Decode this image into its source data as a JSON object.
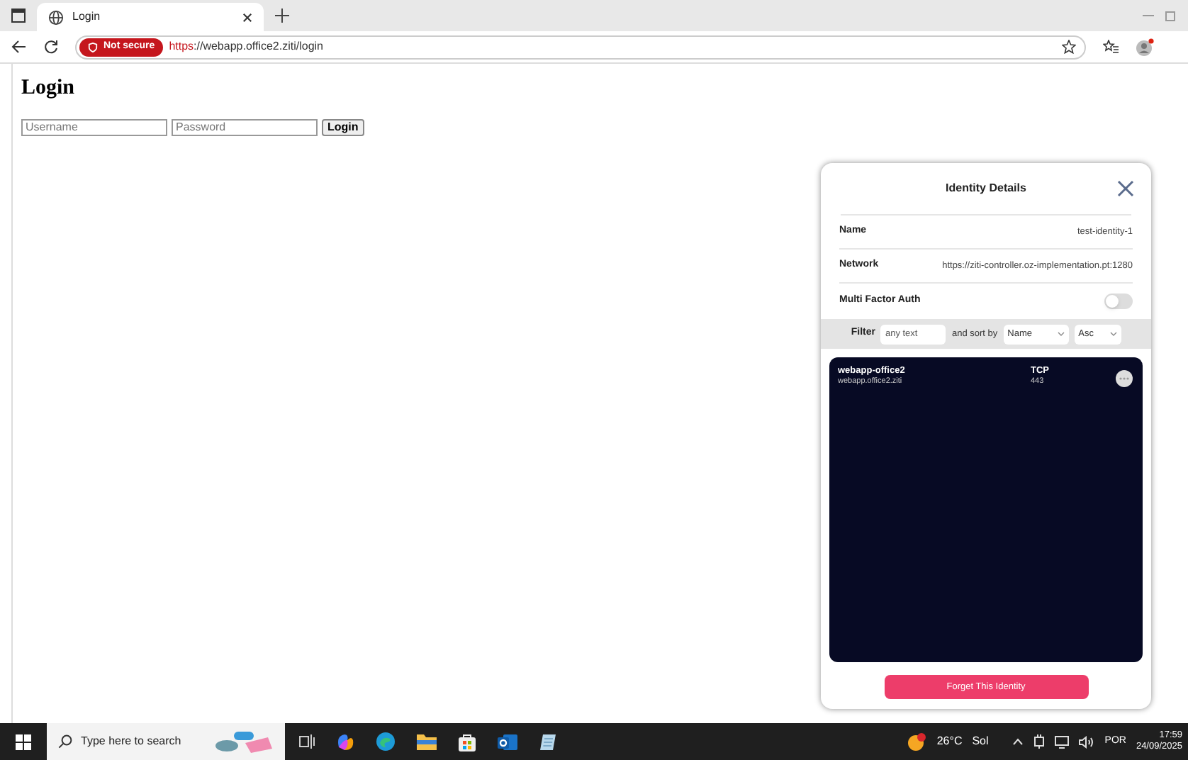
{
  "browser": {
    "tab": {
      "title": "Login"
    },
    "address": {
      "security": "Not secure",
      "scheme": "https",
      "rest": "://webapp.office2.ziti/login"
    }
  },
  "page": {
    "heading": "Login",
    "username": {
      "placeholder": "Username"
    },
    "password": {
      "placeholder": "Password"
    },
    "submit": "Login"
  },
  "popup": {
    "title": "Identity Details",
    "fields": [
      {
        "label": "Name",
        "value": "test-identity-1"
      },
      {
        "label": "Network",
        "value": "https://ziti-controller.oz-implementation.pt:1280"
      }
    ],
    "mfa": {
      "label": "Multi Factor Auth",
      "on": false
    },
    "filter": {
      "label": "Filter",
      "placeholder": "any text",
      "sort_label": "and sort by",
      "sort_field": "Name",
      "order": "Asc"
    },
    "services": [
      {
        "name": "webapp-office2",
        "address": "webapp.office2.ziti",
        "protocol": "TCP",
        "port": "443"
      }
    ],
    "forget_button": "Forget This Identity"
  },
  "taskbar": {
    "search": {
      "placeholder": "Type here to search"
    },
    "weather": {
      "temp": "26°C",
      "condition": "Sol"
    },
    "language": "POR",
    "time": "17:59",
    "date": "24/09/2025"
  }
}
